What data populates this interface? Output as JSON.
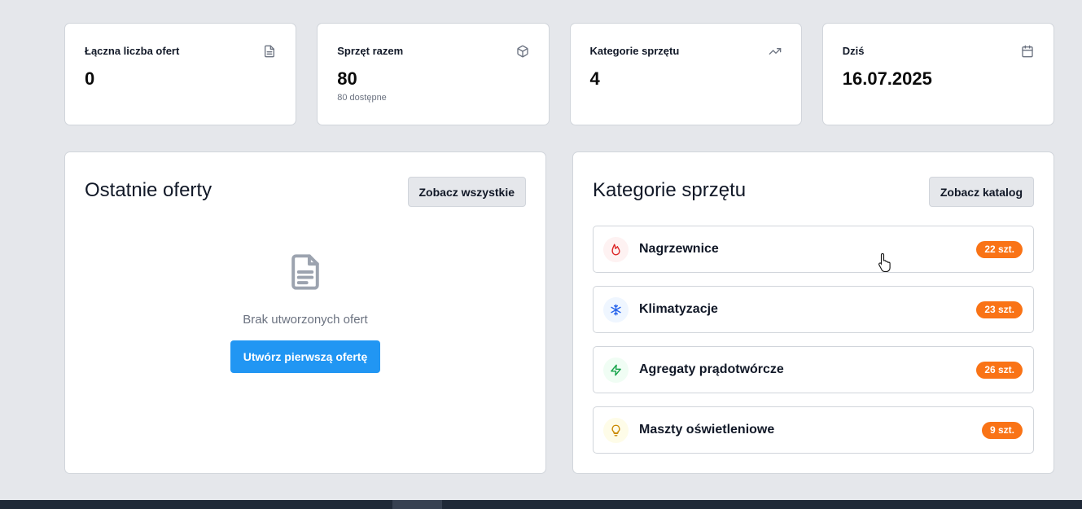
{
  "stats": [
    {
      "title": "Łączna liczba ofert",
      "value": "0",
      "sub": "",
      "icon": "document-icon"
    },
    {
      "title": "Sprzęt razem",
      "value": "80",
      "sub": "80 dostępne",
      "icon": "box-icon"
    },
    {
      "title": "Kategorie sprzętu",
      "value": "4",
      "sub": "",
      "icon": "trending-up-icon"
    },
    {
      "title": "Dziś",
      "value": "16.07.2025",
      "sub": "",
      "icon": "calendar-icon"
    }
  ],
  "recent_offers": {
    "title": "Ostatnie oferty",
    "see_all_label": "Zobacz wszystkie",
    "empty_text": "Brak utworzonych ofert",
    "create_label": "Utwórz pierwszą ofertę"
  },
  "categories": {
    "title": "Kategorie sprzętu",
    "catalog_label": "Zobacz katalog",
    "items": [
      {
        "label": "Nagrzewnice",
        "badge": "22 szt.",
        "icon": "flame-icon",
        "color": "#dc2626",
        "bg": "#fef2f2"
      },
      {
        "label": "Klimatyzacje",
        "badge": "23 szt.",
        "icon": "snowflake-icon",
        "color": "#2563eb",
        "bg": "#eff6ff"
      },
      {
        "label": "Agregaty prądotwórcze",
        "badge": "26 szt.",
        "icon": "lightning-icon",
        "color": "#16a34a",
        "bg": "#f0fdf4"
      },
      {
        "label": "Maszty oświetleniowe",
        "badge": "9 szt.",
        "icon": "lightbulb-icon",
        "color": "#ca8a04",
        "bg": "#fefce8"
      }
    ]
  },
  "colors": {
    "accent": "#2196f3",
    "badge": "#f97316",
    "background": "#e5e7eb"
  }
}
